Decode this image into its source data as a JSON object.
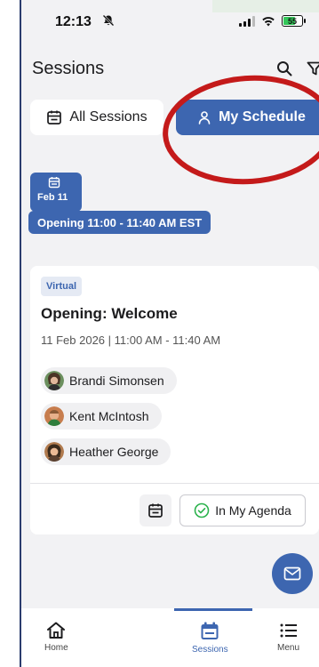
{
  "status_bar": {
    "time": "12:13",
    "battery": "55"
  },
  "header": {
    "title": "Sessions"
  },
  "tabs": {
    "all_sessions": "All Sessions",
    "my_schedule": "My Schedule"
  },
  "date_chip": {
    "label": "Feb 11"
  },
  "time_filter": {
    "label": "Opening 11:00 - 11:40 AM EST"
  },
  "session": {
    "badge": "Virtual",
    "title": "Opening: Welcome",
    "datetime": "11 Feb 2026 | 11:00 AM - 11:40 AM",
    "speakers": [
      {
        "name": "Brandi Simonsen"
      },
      {
        "name": "Kent McIntosh"
      },
      {
        "name": "Heather George"
      }
    ],
    "agenda_button": "In My Agenda"
  },
  "bottom_nav": {
    "home": "Home",
    "sessions": "Sessions",
    "menu": "Menu"
  },
  "colors": {
    "accent": "#3d66b0",
    "annotation": "#c41a1a",
    "success": "#2bb24c"
  }
}
